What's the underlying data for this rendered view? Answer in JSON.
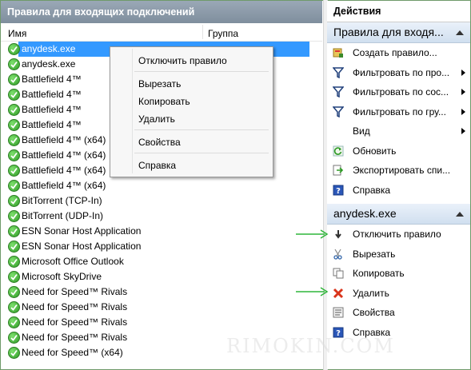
{
  "left_panel": {
    "title": "Правила для входящих подключений",
    "columns": {
      "name": "Имя",
      "group": "Группа"
    },
    "rows": [
      "anydesk.exe",
      "anydesk.exe",
      "Battlefield 4™",
      "Battlefield 4™",
      "Battlefield 4™",
      "Battlefield 4™",
      "Battlefield 4™ (x64)",
      "Battlefield 4™ (x64)",
      "Battlefield 4™ (x64)",
      "Battlefield 4™ (x64)",
      "BitTorrent (TCP-In)",
      "BitTorrent (UDP-In)",
      "ESN Sonar Host Application",
      "ESN Sonar Host Application",
      "Microsoft Office Outlook",
      "Microsoft SkyDrive",
      "Need for Speed™ Rivals",
      "Need for Speed™ Rivals",
      "Need for Speed™ Rivals",
      "Need for Speed™ Rivals",
      "Need for Speed™ (x64)"
    ]
  },
  "context_menu": {
    "disable_rule": "Отключить правило",
    "cut": "Вырезать",
    "copy": "Копировать",
    "delete": "Удалить",
    "properties": "Свойства",
    "help": "Справка"
  },
  "actions_panel": {
    "title": "Действия",
    "section_rules": "Правила для входя...",
    "rules_items": {
      "new_rule": "Создать правило...",
      "filter_profile": "Фильтровать по про...",
      "filter_state": "Фильтровать по сос...",
      "filter_group": "Фильтровать по гру...",
      "view": "Вид",
      "refresh": "Обновить",
      "export": "Экспортировать спи...",
      "help": "Справка"
    },
    "section_item": "anydesk.exe",
    "item_actions": {
      "disable_rule": "Отключить правило",
      "cut": "Вырезать",
      "copy": "Копировать",
      "delete": "Удалить",
      "properties": "Свойства",
      "help": "Справка"
    }
  },
  "watermark": "RIMOKIN.COM",
  "colors": {
    "selection": "#3399ff",
    "header": "#8a98a7",
    "annotation_arrow": "#2fb53a",
    "check": "#3fb532"
  }
}
